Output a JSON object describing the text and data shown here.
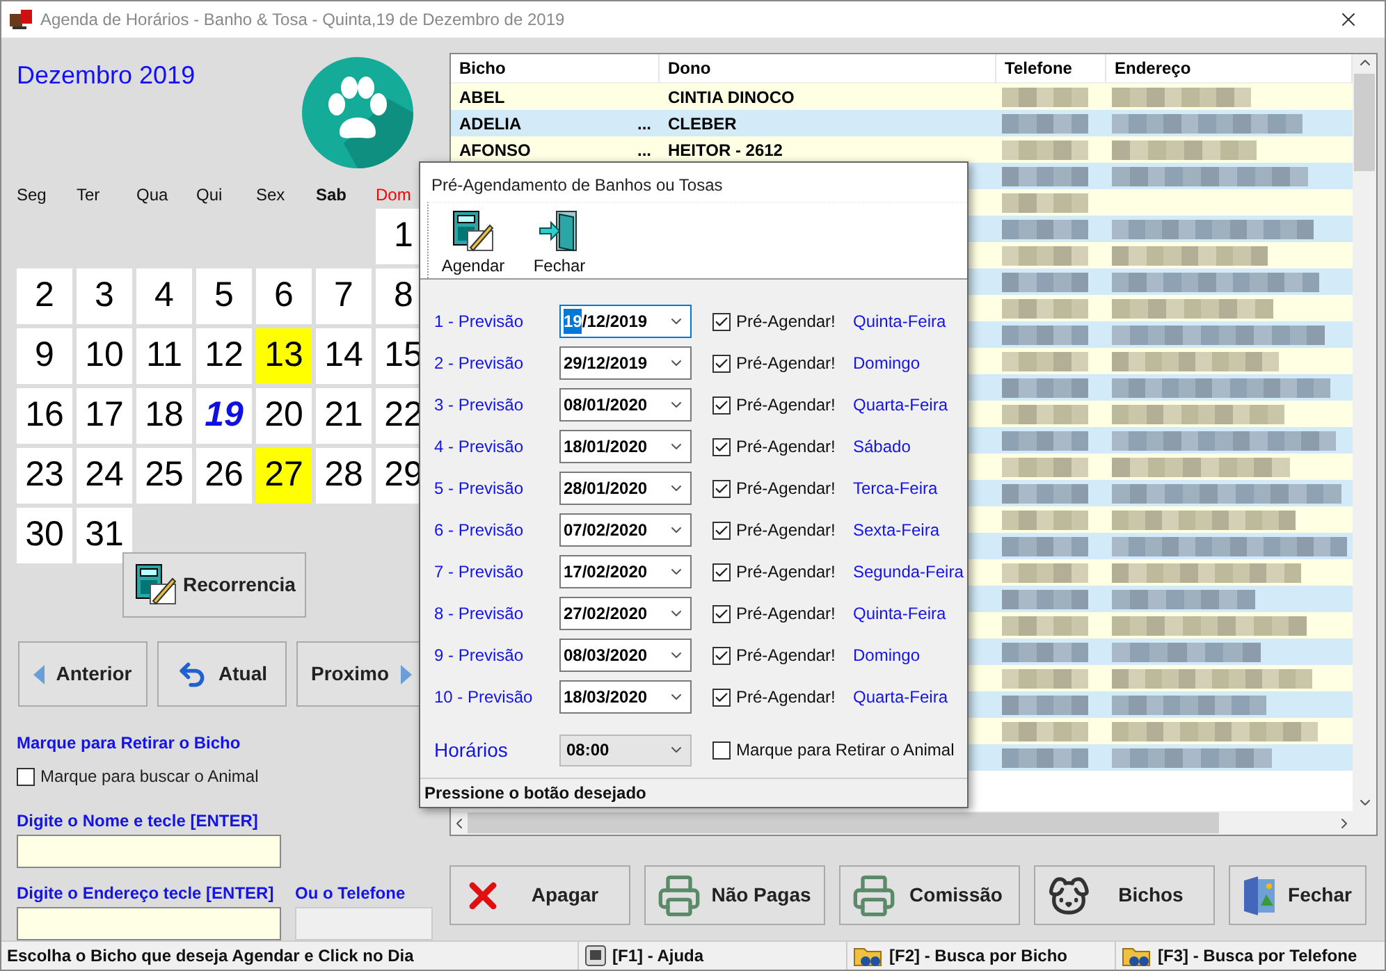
{
  "window": {
    "title": "Agenda de Horários - Banho & Tosa - Quinta,19 de Dezembro de 2019"
  },
  "calendar": {
    "month": "Dezembro 2019",
    "weekdays": [
      {
        "label": "Seg",
        "kind": "normal"
      },
      {
        "label": "Ter",
        "kind": "normal"
      },
      {
        "label": "Qua",
        "kind": "normal"
      },
      {
        "label": "Qui",
        "kind": "normal"
      },
      {
        "label": "Sex",
        "kind": "normal"
      },
      {
        "label": "Sab",
        "kind": "bold"
      },
      {
        "label": "Dom",
        "kind": "red"
      }
    ],
    "weeks": [
      [
        {
          "kind": "blank"
        },
        {
          "kind": "blank"
        },
        {
          "kind": "blank"
        },
        {
          "kind": "blank"
        },
        {
          "kind": "blank"
        },
        {
          "kind": "blank"
        },
        {
          "kind": "day",
          "day": "1",
          "highlighted": false,
          "today": false
        }
      ],
      [
        {
          "kind": "day",
          "day": "2",
          "highlighted": false,
          "today": false
        },
        {
          "kind": "day",
          "day": "3",
          "highlighted": false,
          "today": false
        },
        {
          "kind": "day",
          "day": "4",
          "highlighted": false,
          "today": false
        },
        {
          "kind": "day",
          "day": "5",
          "highlighted": false,
          "today": false
        },
        {
          "kind": "day",
          "day": "6",
          "highlighted": false,
          "today": false
        },
        {
          "kind": "day",
          "day": "7",
          "highlighted": false,
          "today": false
        },
        {
          "kind": "day",
          "day": "8",
          "highlighted": false,
          "today": false
        }
      ],
      [
        {
          "kind": "day",
          "day": "9",
          "highlighted": false,
          "today": false
        },
        {
          "kind": "day",
          "day": "10",
          "highlighted": false,
          "today": false
        },
        {
          "kind": "day",
          "day": "11",
          "highlighted": false,
          "today": false
        },
        {
          "kind": "day",
          "day": "12",
          "highlighted": false,
          "today": false
        },
        {
          "kind": "day",
          "day": "13",
          "highlighted": true,
          "today": false
        },
        {
          "kind": "day",
          "day": "14",
          "highlighted": false,
          "today": false
        },
        {
          "kind": "day",
          "day": "15",
          "highlighted": false,
          "today": false
        }
      ],
      [
        {
          "kind": "day",
          "day": "16",
          "highlighted": false,
          "today": false
        },
        {
          "kind": "day",
          "day": "17",
          "highlighted": false,
          "today": false
        },
        {
          "kind": "day",
          "day": "18",
          "highlighted": false,
          "today": false
        },
        {
          "kind": "day",
          "day": "19",
          "highlighted": false,
          "today": true
        },
        {
          "kind": "day",
          "day": "20",
          "highlighted": false,
          "today": false
        },
        {
          "kind": "day",
          "day": "21",
          "highlighted": false,
          "today": false
        },
        {
          "kind": "day",
          "day": "22",
          "highlighted": false,
          "today": false
        }
      ],
      [
        {
          "kind": "day",
          "day": "23",
          "highlighted": false,
          "today": false
        },
        {
          "kind": "day",
          "day": "24",
          "highlighted": false,
          "today": false
        },
        {
          "kind": "day",
          "day": "25",
          "highlighted": false,
          "today": false
        },
        {
          "kind": "day",
          "day": "26",
          "highlighted": false,
          "today": false
        },
        {
          "kind": "day",
          "day": "27",
          "highlighted": true,
          "today": false
        },
        {
          "kind": "day",
          "day": "28",
          "highlighted": false,
          "today": false
        },
        {
          "kind": "day",
          "day": "29",
          "highlighted": false,
          "today": false
        }
      ],
      [
        {
          "kind": "day",
          "day": "30",
          "highlighted": false,
          "today": false
        },
        {
          "kind": "day",
          "day": "31",
          "highlighted": false,
          "today": false
        }
      ]
    ]
  },
  "recorrencia": {
    "label": "Recorrencia"
  },
  "navigation": [
    {
      "label": "Anterior",
      "kind": "prev"
    },
    {
      "label": "Atual",
      "kind": "current"
    },
    {
      "label": "Proximo",
      "kind": "next"
    }
  ],
  "retirar": {
    "heading": "Marque para Retirar o Bicho",
    "checkbox": {
      "label": "Marque para buscar o Animal",
      "checked": false
    }
  },
  "search": {
    "name_label": "Digite o Nome e tecle [ENTER]",
    "address_label": "Digite o Endereço tecle [ENTER]",
    "phone_label": "Ou o Telefone"
  },
  "table": {
    "columns": [
      "Bicho",
      "Dono",
      "Telefone",
      "Endereço"
    ],
    "rows": [
      {
        "bicho": "ABEL",
        "dono": "CINTIA DINOCO"
      },
      {
        "bicho": "ADELIA",
        "more": "...",
        "dono": "CLEBER"
      },
      {
        "bicho": "AFONSO",
        "more": "...",
        "dono": "HEITOR - 2612"
      }
    ]
  },
  "dialog": {
    "title": "Pré-Agendamento de Banhos ou Tosas",
    "tools": [
      {
        "label": "Agendar",
        "kind": "calculator"
      },
      {
        "label": "Fechar",
        "kind": "door"
      }
    ],
    "rows": [
      {
        "label": "1 - Previsão",
        "date": "19/12/2019",
        "focused": true,
        "check_label": "Pré-Agendar!",
        "checked": true,
        "weekday": "Quinta-Feira"
      },
      {
        "label": "2 - Previsão",
        "date": "29/12/2019",
        "focused": false,
        "check_label": "Pré-Agendar!",
        "checked": true,
        "weekday": "Domingo"
      },
      {
        "label": "3 - Previsão",
        "date": "08/01/2020",
        "focused": false,
        "check_label": "Pré-Agendar!",
        "checked": true,
        "weekday": "Quarta-Feira"
      },
      {
        "label": "4 - Previsão",
        "date": "18/01/2020",
        "focused": false,
        "check_label": "Pré-Agendar!",
        "checked": true,
        "weekday": "Sábado"
      },
      {
        "label": "5 - Previsão",
        "date": "28/01/2020",
        "focused": false,
        "check_label": "Pré-Agendar!",
        "checked": true,
        "weekday": "Terca-Feira"
      },
      {
        "label": "6 - Previsão",
        "date": "07/02/2020",
        "focused": false,
        "check_label": "Pré-Agendar!",
        "checked": true,
        "weekday": "Sexta-Feira"
      },
      {
        "label": "7 - Previsão",
        "date": "17/02/2020",
        "focused": false,
        "check_label": "Pré-Agendar!",
        "checked": true,
        "weekday": "Segunda-Feira"
      },
      {
        "label": "8 - Previsão",
        "date": "27/02/2020",
        "focused": false,
        "check_label": "Pré-Agendar!",
        "checked": true,
        "weekday": "Quinta-Feira"
      },
      {
        "label": "9 - Previsão",
        "date": "08/03/2020",
        "focused": false,
        "check_label": "Pré-Agendar!",
        "checked": true,
        "weekday": "Domingo"
      },
      {
        "label": "10 - Previsão",
        "date": "18/03/2020",
        "focused": false,
        "check_label": "Pré-Agendar!",
        "checked": true,
        "weekday": "Quarta-Feira"
      }
    ],
    "horarios": {
      "label": "Horários",
      "value": "08:00"
    },
    "retirar": {
      "label": "Marque para Retirar o Animal",
      "checked": false
    },
    "status": "Pressione o botão desejado"
  },
  "buttons": [
    {
      "label": "Apagar",
      "kind": "delete"
    },
    {
      "label": "Não Pagas",
      "kind": "printer"
    },
    {
      "label": "Comissão",
      "kind": "printer"
    },
    {
      "label": "Bichos",
      "kind": "dog"
    },
    {
      "label": "Fechar",
      "kind": "exit"
    }
  ],
  "status_bar": {
    "message": "Escolha o Bicho que deseja Agendar e Click no Dia",
    "keys": [
      {
        "label": "[F1] - Ajuda",
        "kind": "key"
      },
      {
        "label": "[F2] - Busca por Bicho",
        "kind": "search"
      },
      {
        "label": "[F3] - Busca por Telefone",
        "kind": "search"
      }
    ]
  }
}
